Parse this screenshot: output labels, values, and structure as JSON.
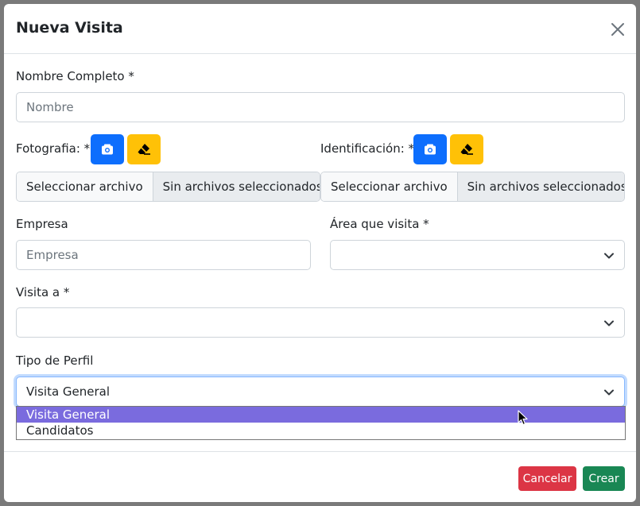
{
  "modal": {
    "title": "Nueva Visita"
  },
  "form": {
    "nombre": {
      "label": "Nombre Completo *",
      "placeholder": "Nombre",
      "value": ""
    },
    "fotografia": {
      "label": "Fotografia: *",
      "choose_label": "Seleccionar archivo",
      "status": "Sin archivos seleccionados",
      "camera_icon": "camera-icon",
      "eraser_icon": "eraser-icon"
    },
    "identificacion": {
      "label": "Identificación: *",
      "choose_label": "Seleccionar archivo",
      "status": "Sin archivos seleccionados",
      "camera_icon": "camera-icon",
      "eraser_icon": "eraser-icon"
    },
    "empresa": {
      "label": "Empresa",
      "placeholder": "Empresa",
      "value": ""
    },
    "area": {
      "label": "Área que visita *",
      "selected": ""
    },
    "visita_a": {
      "label": "Visita a *",
      "selected": ""
    },
    "tipo_perfil": {
      "label": "Tipo de Perfil",
      "selected": "Visita General",
      "options": [
        "Visita General",
        "Candidatos"
      ],
      "highlighted_option": "Visita General"
    }
  },
  "footer": {
    "cancel_label": "Cancelar",
    "create_label": "Crear"
  },
  "colors": {
    "primary": "#0d6efd",
    "warning": "#ffc107",
    "danger": "#dc3545",
    "success": "#198754",
    "option_highlight": "#7a6bde"
  }
}
